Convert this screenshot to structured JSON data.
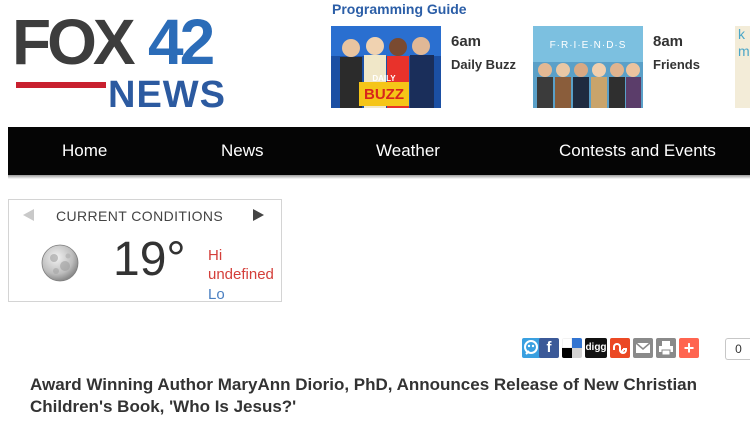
{
  "brand": {
    "logo_top": "FOX42",
    "logo_bottom": "NEWS",
    "colors": {
      "fox": "#3d3d3d",
      "number": "#2b6cb8",
      "news": "#2c5aa0",
      "stripe": "#c8202f"
    }
  },
  "programming_guide": {
    "title": "Programming Guide",
    "items": [
      {
        "time": "6am",
        "show": "Daily Buzz",
        "thumb_text": "THE DAILY BUZZ"
      },
      {
        "time": "8am",
        "show": "Friends",
        "thumb_text": "F·R·I·E·N·D·S"
      }
    ],
    "partial_text": [
      "k",
      "m"
    ]
  },
  "nav": {
    "items": [
      "Home",
      "News",
      "Weather",
      "Contests and Events"
    ]
  },
  "weather": {
    "title": "CURRENT CONDITIONS",
    "icon": "moon-icon",
    "temperature": "19°",
    "hi_label": "Hi",
    "hi_value": "undefined",
    "lo_label": "Lo"
  },
  "share": {
    "icons": [
      "share-this-icon",
      "facebook-icon",
      "delicious-icon",
      "digg-icon",
      "stumbleupon-icon",
      "email-icon",
      "print-icon",
      "add-icon"
    ],
    "digg_label": "digg",
    "count": "0"
  },
  "article": {
    "headline": "Award Winning Author MaryAnn Diorio, PhD, Announces Release of New Christian Children's Book, 'Who Is Jesus?'"
  }
}
